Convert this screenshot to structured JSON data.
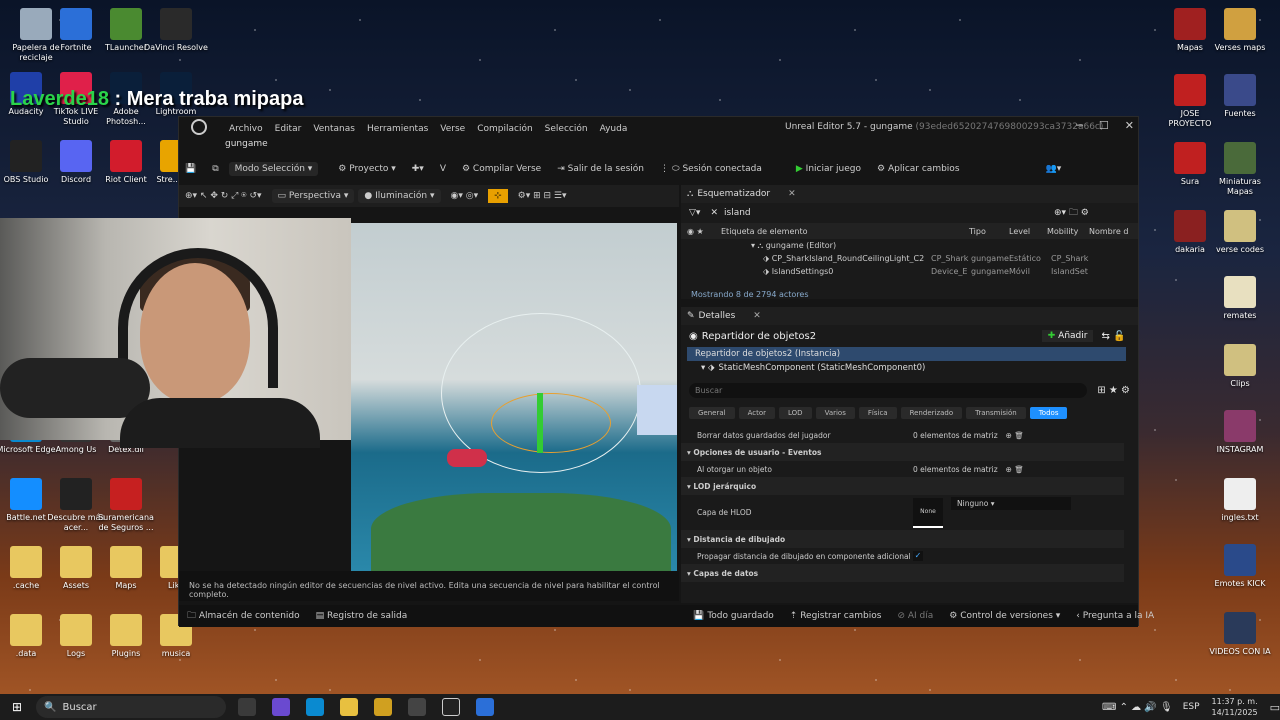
{
  "desktop": {
    "left_icons": [
      {
        "label": "Papelera de reciclaje",
        "color": "#9ab"
      },
      {
        "label": "Fortnite",
        "color": "#2b6fd8"
      },
      {
        "label": "TLauncher",
        "color": "#4a8a30"
      },
      {
        "label": "DaVinci Resolve",
        "color": "#2a2a2a"
      },
      {
        "label": "Audacity",
        "color": "#1f3fa8"
      },
      {
        "label": "TikTok LIVE Studio",
        "color": "#e0204a"
      },
      {
        "label": "Adobe Photosh...",
        "color": "#0a1f3a"
      },
      {
        "label": "Lightroom",
        "color": "#0a1f3a"
      },
      {
        "label": "OBS Studio",
        "color": "#222"
      },
      {
        "label": "Discord",
        "color": "#5865f2"
      },
      {
        "label": "Riot Client",
        "color": "#d21c2c"
      },
      {
        "label": "Stre... E...",
        "color": "#e8a400"
      },
      {
        "label": "Microsoft Edge",
        "color": "#0a8ad0"
      },
      {
        "label": "Among Us",
        "color": "#333"
      },
      {
        "label": "Detex.dll",
        "color": "#666"
      },
      {
        "label": "Battle.net",
        "color": "#148eff"
      },
      {
        "label": "Descubre más acer...",
        "color": "#222"
      },
      {
        "label": "Suramericana de Seguros ...",
        "color": "#c62020"
      },
      {
        "label": ".cache",
        "color": "#e8c860"
      },
      {
        "label": "Assets",
        "color": "#e8c860"
      },
      {
        "label": "Maps",
        "color": "#e8c860"
      },
      {
        "label": "Like",
        "color": "#e8c860"
      },
      {
        "label": ".data",
        "color": "#e8c860"
      },
      {
        "label": "Logs",
        "color": "#e8c860"
      },
      {
        "label": "Plugins",
        "color": "#e8c860"
      },
      {
        "label": "musica",
        "color": "#e8c860"
      }
    ],
    "right_icons": [
      {
        "label": "Mapas",
        "color": "#a02020"
      },
      {
        "label": "Verses maps",
        "color": "#d0a040"
      },
      {
        "label": "JOSE PROYECTO",
        "color": "#c02020"
      },
      {
        "label": "Fuentes",
        "color": "#3a4a8a"
      },
      {
        "label": "Sura",
        "color": "#c02020"
      },
      {
        "label": "Miniaturas Mapas",
        "color": "#4a6a3a"
      },
      {
        "label": "dakaria",
        "color": "#8a2020"
      },
      {
        "label": "verse codes",
        "color": "#d0c080"
      },
      {
        "label": "remates",
        "color": "#e8e0c0"
      },
      {
        "label": "Clips",
        "color": "#d0c080"
      },
      {
        "label": "INSTAGRAM",
        "color": "#8a3a6a"
      },
      {
        "label": "ingles.txt",
        "color": "#eee"
      },
      {
        "label": "Emotes KICK",
        "color": "#2a4a8a"
      },
      {
        "label": "VIDEOS CON IA",
        "color": "#2a3a5a"
      }
    ]
  },
  "overlay": {
    "user": "Laverde18",
    "sep": " : ",
    "message": "Mera traba mipapa"
  },
  "editor": {
    "menu": [
      "Archivo",
      "Editar",
      "Ventanas",
      "Herramientas",
      "Verse",
      "Compilación",
      "Selección",
      "Ayuda"
    ],
    "window_title": "Unreal Editor 5.7 - gungame",
    "window_id": "(93eded6520274769800293ca3732a66c)",
    "tab_label": "gungame",
    "toolbar": {
      "mode": "Modo Selección",
      "project": "Proyecto",
      "compile": "Compilar Verse",
      "exit_session": "Salir de la sesión",
      "session": "Sesión conectada",
      "start": "Iniciar juego",
      "apply": "Aplicar cambios"
    },
    "viewport": {
      "perspective": "Perspectiva",
      "lighting": "Iluminación",
      "status": "No se ha detectado ningún editor de secuencias de nivel activo. Edita una secuencia de nivel para habilitar el control completo."
    },
    "bottom": {
      "content": "Almacén de contenido",
      "log": "Registro de salida",
      "saved": "Todo guardado",
      "changes": "Registrar cambios",
      "ai": "AI día",
      "vcs": "Control de versiones",
      "ask_ai": "Pregunta a la IA"
    },
    "outliner": {
      "title": "Esquematizador",
      "search": "island",
      "columns": [
        "Etiqueta de elemento",
        "Tipo",
        "Level",
        "Mobility",
        "Nombre d"
      ],
      "rows": [
        {
          "label": "gungame (Editor)",
          "tipo": "",
          "level": "",
          "mobility": "",
          "name": ""
        },
        {
          "label": "CP_SharkIsland_RoundCeilingLight_C2",
          "tipo": "CP_Shark",
          "level": "gungame",
          "mobility": "Estático",
          "name": "CP_Shark"
        },
        {
          "label": "IslandSettings0",
          "tipo": "Device_E",
          "level": "gungame",
          "mobility": "Móvil",
          "name": "IslandSet"
        }
      ],
      "count": "Mostrando 8 de 2794 actores"
    },
    "details": {
      "title": "Detalles",
      "actor": "Repartidor de objetos2",
      "add": "Añadir",
      "instance": "Repartidor de objetos2 (Instancia)",
      "component": "StaticMeshComponent (StaticMeshComponent0)",
      "search_placeholder": "Buscar",
      "categories": [
        "General",
        "Actor",
        "LOD",
        "Varios",
        "Física",
        "Renderizado",
        "Transmisión",
        "Todos"
      ],
      "props": [
        {
          "type": "prop",
          "k": "Borrar datos guardados del jugador",
          "v": "0 elementos de matriz"
        },
        {
          "type": "sect",
          "k": "Opciones de usuario - Eventos"
        },
        {
          "type": "prop",
          "k": "Al otorgar un objeto",
          "v": "0 elementos de matriz"
        },
        {
          "type": "sect",
          "k": "LOD jerárquico"
        },
        {
          "type": "hlod",
          "k": "Capa de HLOD",
          "thumb": "None",
          "v": "Ninguno"
        },
        {
          "type": "sect",
          "k": "Distancia de dibujado"
        },
        {
          "type": "check",
          "k": "Propagar distancia de dibujado en componente adicional"
        },
        {
          "type": "sect",
          "k": "Capas de datos"
        }
      ]
    }
  },
  "taskbar": {
    "search": "Buscar",
    "lang": "ESP",
    "time": "11:37 p. m.",
    "date": "14/11/2025"
  }
}
